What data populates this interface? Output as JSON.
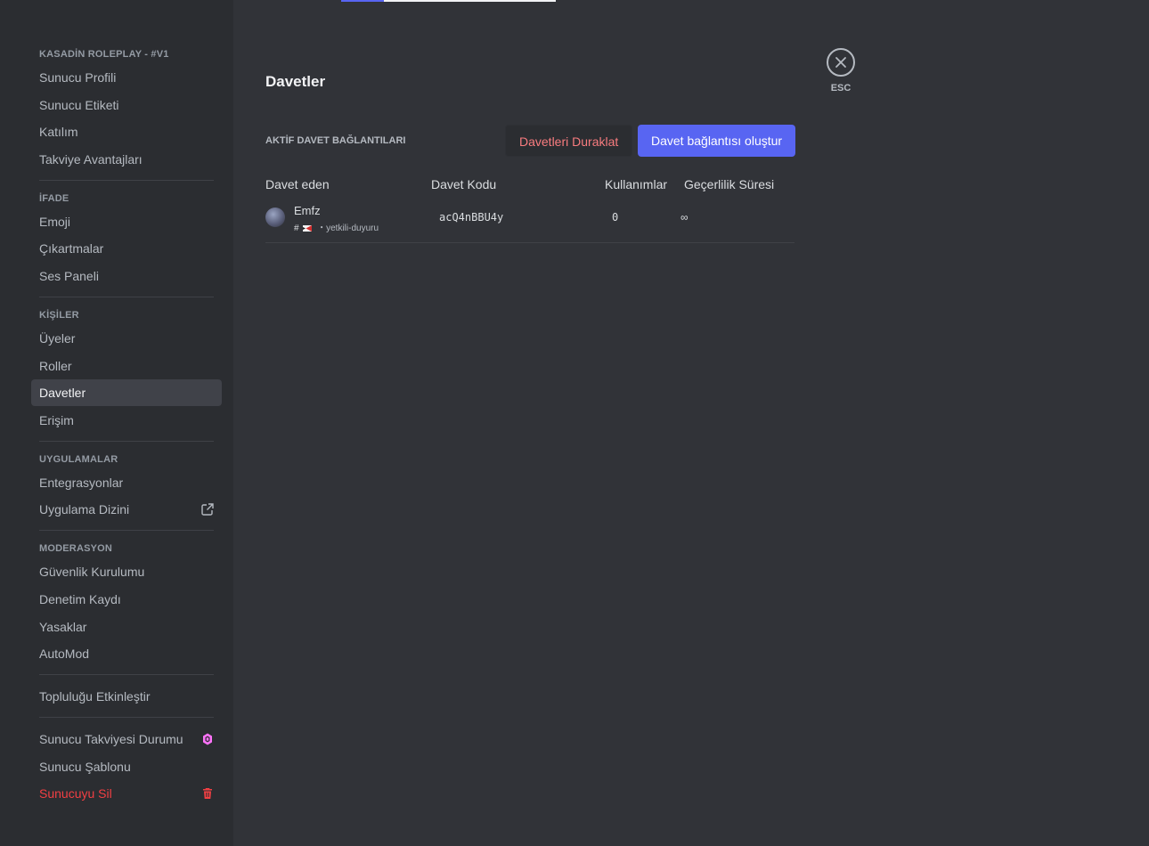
{
  "sidebar": {
    "server_header": "KASADİN ROLEPLAY - #V1",
    "server_items": [
      "Sunucu Profili",
      "Sunucu Etiketi",
      "Katılım",
      "Takviye Avantajları"
    ],
    "expression_header": "İFADE",
    "expression_items": [
      "Emoji",
      "Çıkartmalar",
      "Ses Paneli"
    ],
    "people_header": "KİŞİLER",
    "people_items": [
      "Üyeler",
      "Roller",
      "Davetler",
      "Erişim"
    ],
    "apps_header": "UYGULAMALAR",
    "apps_items": [
      "Entegrasyonlar",
      "Uygulama Dizini"
    ],
    "moderation_header": "MODERASYON",
    "moderation_items": [
      "Güvenlik Kurulumu",
      "Denetim Kaydı",
      "Yasaklar",
      "AutoMod"
    ],
    "community_item": "Topluluğu Etkinleştir",
    "bottom_items": [
      "Sunucu Takviyesi Durumu",
      "Sunucu Şablonu",
      "Sunucuyu Sil"
    ],
    "active_item": "Davetler"
  },
  "main": {
    "title": "Davetler",
    "section_label": "AKTİF DAVET BAĞLANTILARI",
    "pause_button": "Davetleri Duraklat",
    "create_button": "Davet bağlantısı oluştur",
    "columns": [
      "Davet eden",
      "Davet Kodu",
      "Kullanımlar",
      "Geçerlilik Süresi"
    ],
    "invites": [
      {
        "inviter": "Emfz",
        "channel_prefix": "#",
        "channel": "・yetkili-duyuru",
        "code": "acQ4nBBU4y",
        "uses": "0",
        "expires": "∞"
      }
    ]
  },
  "close": {
    "label": "ESC"
  },
  "colors": {
    "accent": "#5865f2",
    "danger": "#f23f43",
    "boost": "#ff73fa"
  },
  "icons": [
    "external-link-icon",
    "boost-gem-icon",
    "trash-icon",
    "close-icon",
    "flag-icon"
  ]
}
